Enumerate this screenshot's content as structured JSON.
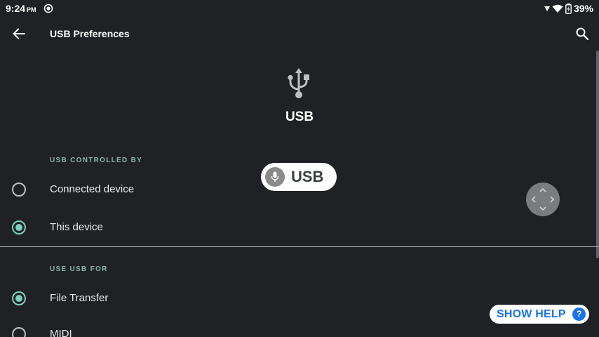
{
  "status_bar": {
    "time": "9:24",
    "ampm": "PM",
    "battery": "39%"
  },
  "app_bar": {
    "title": "USB Preferences"
  },
  "header": {
    "title": "USB"
  },
  "sections": {
    "controlled_by": {
      "label": "USB CONTROLLED BY",
      "options": [
        {
          "label": "Connected device",
          "selected": false
        },
        {
          "label": "This device",
          "selected": true
        }
      ]
    },
    "use_for": {
      "label": "USE USB FOR",
      "options": [
        {
          "label": "File Transfer",
          "selected": true
        },
        {
          "label": "MIDI",
          "selected": false
        }
      ]
    }
  },
  "overlays": {
    "voice_chip_text": "USB",
    "help_text": "SHOW HELP",
    "help_badge": "?"
  },
  "colors": {
    "background": "#202124",
    "accent": "#7fcfbd",
    "help_blue": "#1a73e8"
  }
}
